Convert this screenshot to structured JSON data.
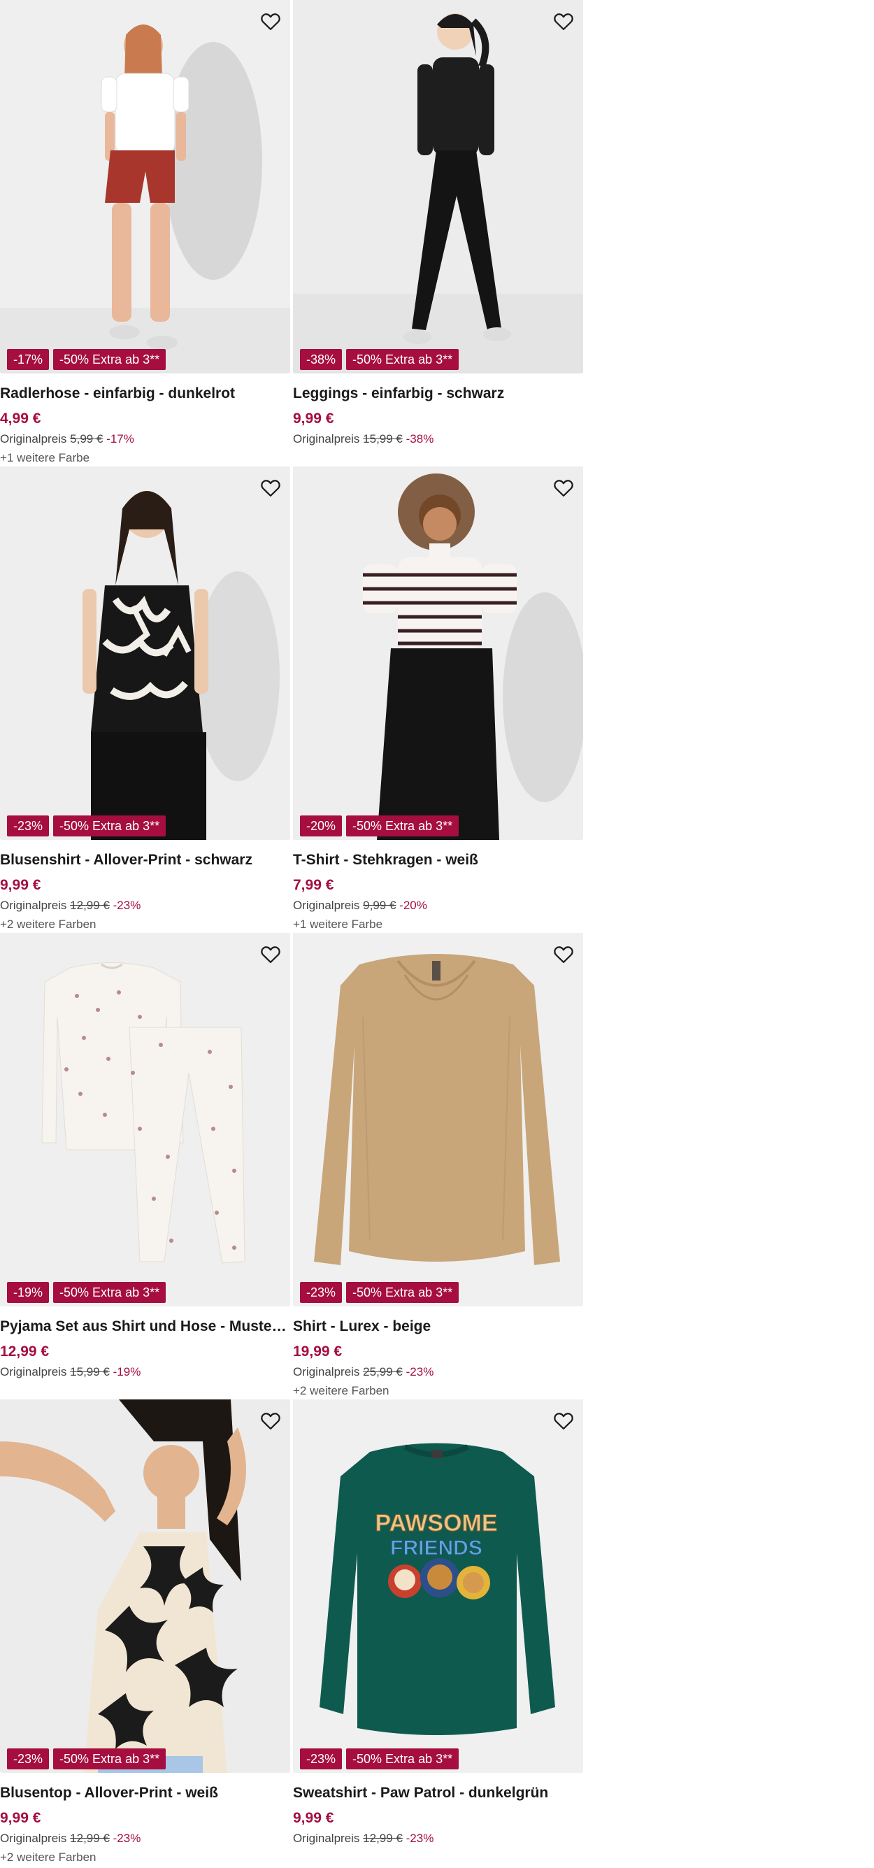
{
  "ui": {
    "wishlist_icon": "heart-outline-icon",
    "original_label": "Originalpreis",
    "badge_color": "#a50e3f",
    "price_color": "#a50e3f"
  },
  "products": [
    {
      "title": "Radlerhose - einfarbig - dunkelrot",
      "price": "4,99 €",
      "original_price": "5,99 €",
      "discount": "-17%",
      "badges": [
        "-17%",
        "-50% Extra ab 3**"
      ],
      "colors_note": "+1 weitere Farbe"
    },
    {
      "title": "Leggings - einfarbig - schwarz",
      "price": "9,99 €",
      "original_price": "15,99 €",
      "discount": "-38%",
      "badges": [
        "-38%",
        "-50% Extra ab 3**"
      ],
      "colors_note": ""
    },
    {
      "title": "Blusenshirt - Allover-Print - schwarz",
      "price": "9,99 €",
      "original_price": "12,99 €",
      "discount": "-23%",
      "badges": [
        "-23%",
        "-50% Extra ab 3**"
      ],
      "colors_note": "+2 weitere Farben"
    },
    {
      "title": "T-Shirt - Stehkragen - weiß",
      "price": "7,99 €",
      "original_price": "9,99 €",
      "discount": "-20%",
      "badges": [
        "-20%",
        "-50% Extra ab 3**"
      ],
      "colors_note": "+1 weitere Farbe"
    },
    {
      "title": "Pyjama Set aus Shirt und Hose - Mustermix - weiß",
      "price": "12,99 €",
      "original_price": "15,99 €",
      "discount": "-19%",
      "badges": [
        "-19%",
        "-50% Extra ab 3**"
      ],
      "colors_note": ""
    },
    {
      "title": "Shirt - Lurex - beige",
      "price": "19,99 €",
      "original_price": "25,99 €",
      "discount": "-23%",
      "badges": [
        "-23%",
        "-50% Extra ab 3**"
      ],
      "colors_note": "+2 weitere Farben"
    },
    {
      "title": "Blusentop - Allover-Print - weiß",
      "price": "9,99 €",
      "original_price": "12,99 €",
      "discount": "-23%",
      "badges": [
        "-23%",
        "-50% Extra ab 3**"
      ],
      "colors_note": "+2 weitere Farben"
    },
    {
      "title": "Sweatshirt - Paw Patrol - dunkelgrün",
      "price": "9,99 €",
      "original_price": "12,99 €",
      "discount": "-23%",
      "badges": [
        "-23%",
        "-50% Extra ab 3**"
      ],
      "colors_note": "",
      "print_text": [
        "PAWSOME",
        "FRIENDS"
      ]
    }
  ]
}
